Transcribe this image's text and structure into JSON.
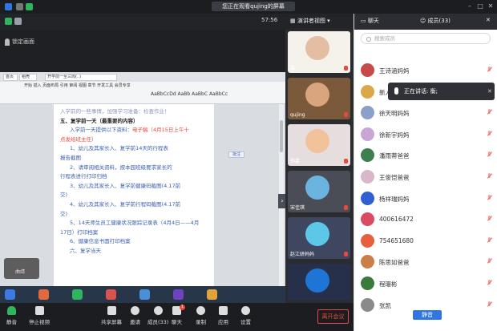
{
  "header": {
    "title": "您正在观看qujing的屏幕"
  },
  "info": {
    "timer": "57:56",
    "lock_label": "锁定画面"
  },
  "document": {
    "tabs": [
      "首页",
      "稻壳",
      "开学前一至三周(..)"
    ],
    "ribbon_styles": "AaBbCcDd  AaBb AaBbC AaBbCc",
    "note_label": "批注",
    "lines": [
      {
        "text": "入学前的一些事情，加强学习准备：检查作业！",
        "style": "faint",
        "red": ""
      },
      {
        "text": "五、复学前一天（最重要的内容）",
        "style": "head",
        "red": ""
      },
      {
        "text": "入学前一天提供以下资料：",
        "style": "indent",
        "red": "电子稿（4月15日上午十"
      },
      {
        "text": "点发给班主任）",
        "style": "red",
        "red": ""
      },
      {
        "text": "1、幼儿及其家长入、复学前14天的行程表",
        "style": "indent",
        "red": ""
      },
      {
        "text": "报告截图",
        "style": "",
        "red": ""
      },
      {
        "text": "2、请审阅相关资料，按本园班级要求家长的",
        "style": "indent",
        "red": ""
      },
      {
        "text": "行程表进行打印归档",
        "style": "",
        "red": ""
      },
      {
        "text": "3、幼儿及其家长入、复学前健康码截图(4.17前",
        "style": "indent",
        "red": ""
      },
      {
        "text": "交)",
        "style": "",
        "red": ""
      },
      {
        "text": "4、幼儿及其家长入、复学前行程码截图(4.17前",
        "style": "indent",
        "red": ""
      },
      {
        "text": "交)",
        "style": "",
        "red": ""
      },
      {
        "text": "5、14天师生员工健康状况跟踪记录表（4月4日——4月",
        "style": "indent",
        "red": ""
      },
      {
        "text": "17日）打印档案",
        "style": "",
        "red": ""
      },
      {
        "text": "6、健康信息书面打印档案",
        "style": "indent",
        "red": ""
      },
      {
        "text": "六、复学当天",
        "style": "indent",
        "red": ""
      }
    ],
    "mini_avatar_label": "曲靖"
  },
  "video_column": {
    "view_label": "演讲者视图",
    "tiles": [
      {
        "name": "果",
        "bg": "#f5f2ec",
        "face": "#e4bda3"
      },
      {
        "name": "qujing",
        "bg": "#7a5a3a",
        "face": "#d9a57f"
      },
      {
        "name": "杨嘉",
        "bg": "#e6dede",
        "face": "#f2c39a"
      },
      {
        "name": "宋佳琪",
        "bg": "#4a4d55",
        "face": "#6bb4e0"
      },
      {
        "name": "赵江妍妈妈",
        "bg": "#3f4660",
        "face": "#5cc7e6"
      },
      {
        "name": "",
        "bg": "#27304a",
        "face": "#1f75d6"
      }
    ]
  },
  "panel": {
    "tabs": {
      "chat": "聊天",
      "members": "成员(33)"
    },
    "search_placeholder": "搜索成员",
    "members": [
      {
        "name": "王诗涵妈妈",
        "color": "#c64a4a"
      },
      {
        "name": "新人小白",
        "color": "#d9a84a"
      },
      {
        "name": "徐天明妈妈",
        "color": "#8aa0c8"
      },
      {
        "name": "徐新宇妈妈",
        "color": "#c9a6d6"
      },
      {
        "name": "潘雨蒂爸爸",
        "color": "#3f7f4f"
      },
      {
        "name": "王俊恺爸爸",
        "color": "#d8b8c8"
      },
      {
        "name": "杨祥瑞妈妈",
        "color": "#2f5fd0"
      },
      {
        "name": "400616472",
        "color": "#d84b63"
      },
      {
        "name": "754651680",
        "color": "#e65f3f"
      },
      {
        "name": "陈思如爸爸",
        "color": "#c97f45"
      },
      {
        "name": "程珊彬",
        "color": "#3a7a3a"
      },
      {
        "name": "张凯",
        "color": "#8a8a8a"
      }
    ],
    "speaking_label": "正在讲话: 衡;",
    "mute_all": "静音"
  },
  "controls": {
    "mute": "静音",
    "stop_video": "停止视频",
    "share": "共享屏幕",
    "invite": "邀请",
    "members": "成员(33)",
    "chat": "聊天",
    "chat_badge": "1",
    "record": "录制",
    "apps": "应用",
    "settings": "设置",
    "leave": "离开会议"
  },
  "colors": {
    "accent_blue": "#2e77e3",
    "leave_red": "#e8493c",
    "video_on_green": "#2fb55d"
  }
}
